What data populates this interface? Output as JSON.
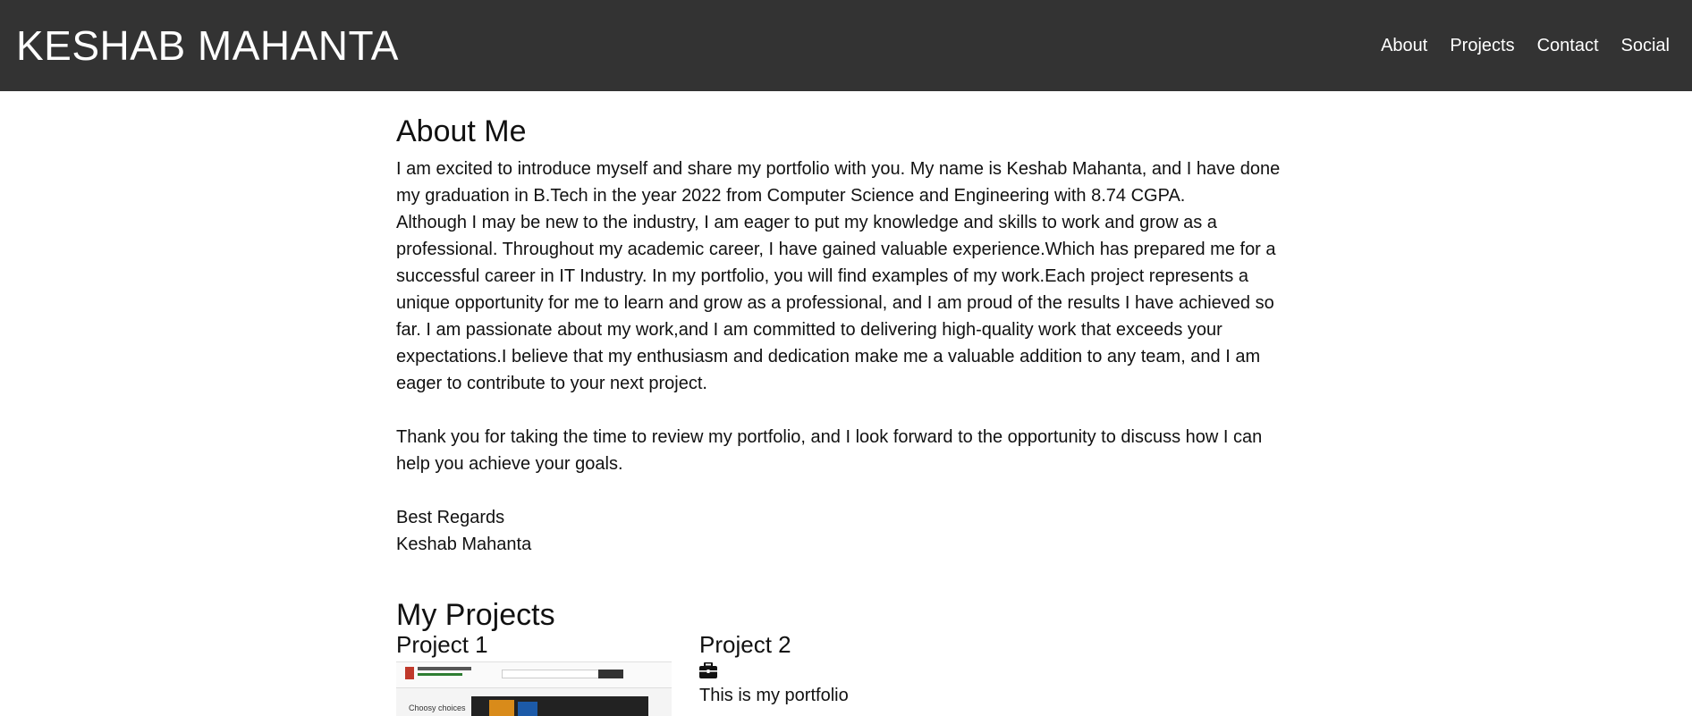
{
  "header": {
    "brand": "KESHAB MAHANTA",
    "nav": [
      "About",
      "Projects",
      "Contact",
      "Social"
    ]
  },
  "about": {
    "title": "About Me",
    "text": "I am excited to introduce myself and share my portfolio with you. My name is Keshab Mahanta, and I have done\nmy graduation in B.Tech in the year 2022 from Computer Science and Engineering with 8.74 CGPA.\nAlthough I may be new to the industry, I am eager to put my knowledge and skills to work and grow as a\nprofessional. Throughout my academic career, I have gained valuable experience.Which has prepared me for a\nsuccessful career in IT Industry. In my portfolio, you will find examples of my work.Each project represents a\nunique opportunity for me to learn and grow as a professional, and I am proud of the results I have achieved so\nfar. I am passionate about my work,and I am committed to delivering high-quality work that exceeds your\nexpectations.I believe that my enthusiasm and dedication make me a valuable addition to any team, and I am\neager to contribute to your next project.\n\nThank you for taking the time to review my portfolio, and I look forward to the opportunity to discuss how I can\nhelp you achieve your goals.\n\nBest Regards\nKeshab Mahanta"
  },
  "projects": {
    "title": "My Projects",
    "items": [
      {
        "title": "Project 1",
        "thumb_tag": "Choosy choices"
      },
      {
        "title": "Project 2",
        "icon": "briefcase-icon",
        "description": "This is my portfolio"
      }
    ]
  },
  "colors": {
    "header_bg": "#333333",
    "header_text": "#ffffff"
  }
}
